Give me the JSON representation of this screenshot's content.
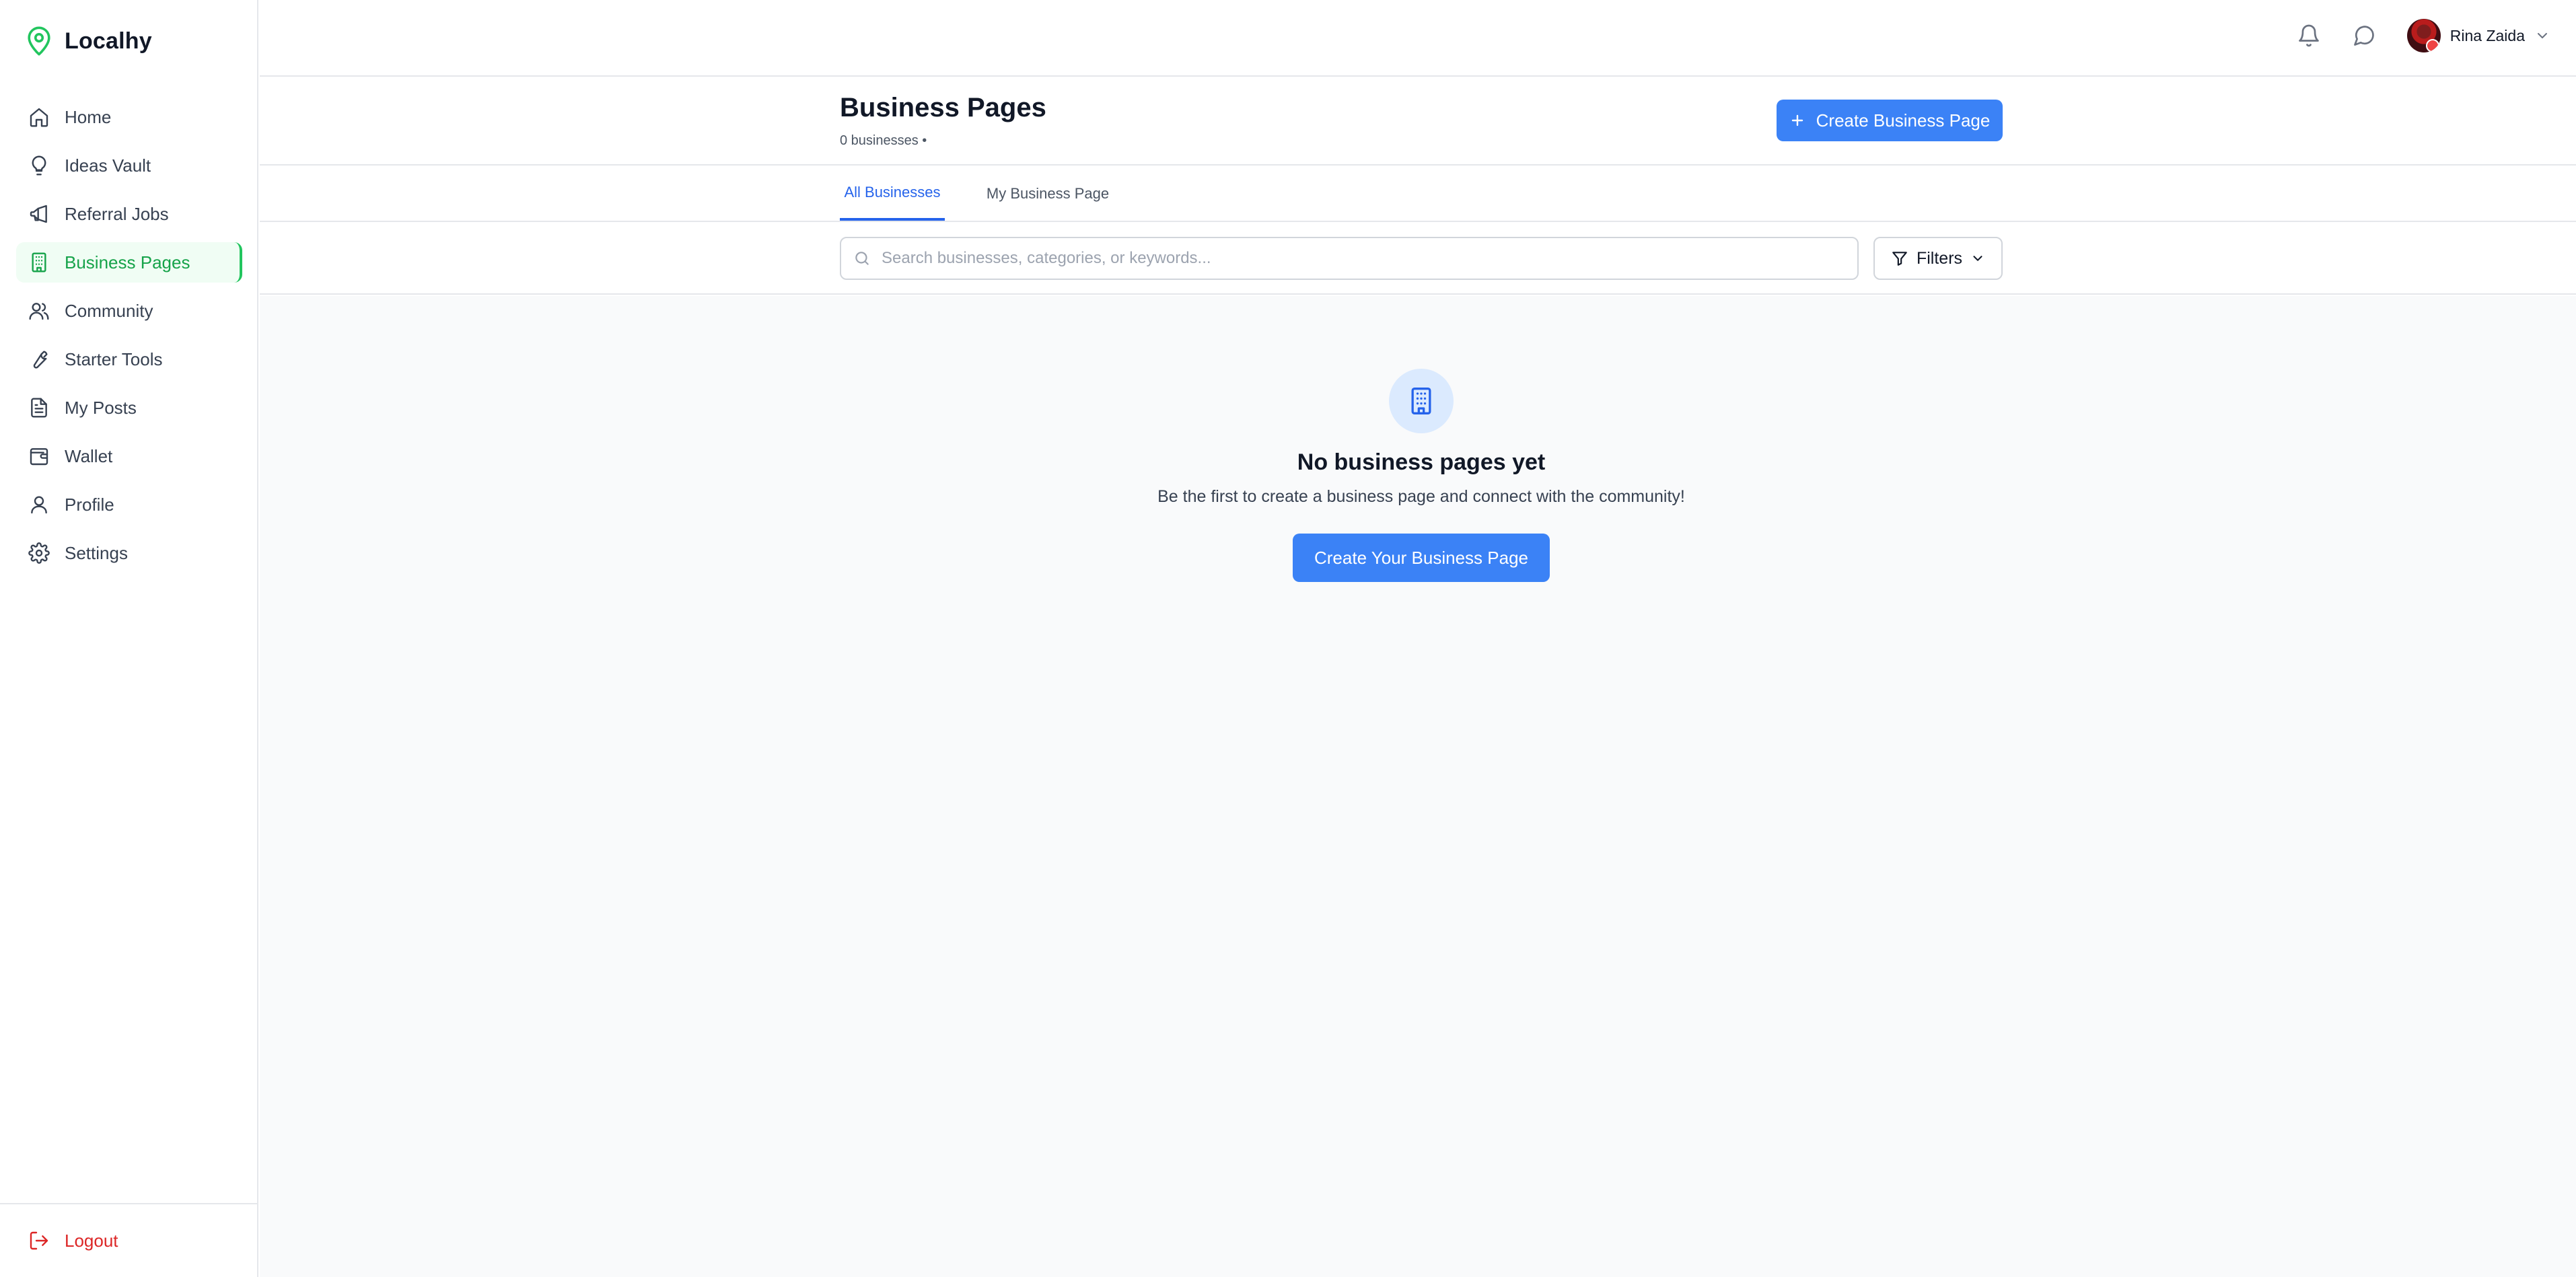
{
  "brand": {
    "name": "Localhy",
    "logo_icon": "map-pin-icon",
    "accent": "#22c55e"
  },
  "sidebar": {
    "items": [
      {
        "label": "Home",
        "icon": "home-icon"
      },
      {
        "label": "Ideas Vault",
        "icon": "lightbulb-icon"
      },
      {
        "label": "Referral Jobs",
        "icon": "megaphone-icon"
      },
      {
        "label": "Business Pages",
        "icon": "building-icon",
        "active": true
      },
      {
        "label": "Community",
        "icon": "users-icon"
      },
      {
        "label": "Starter Tools",
        "icon": "wrench-icon"
      },
      {
        "label": "My Posts",
        "icon": "document-icon"
      },
      {
        "label": "Wallet",
        "icon": "wallet-icon"
      },
      {
        "label": "Profile",
        "icon": "user-icon"
      },
      {
        "label": "Settings",
        "icon": "gear-icon"
      }
    ],
    "logout_label": "Logout",
    "logout_color": "#dc2626"
  },
  "topbar": {
    "user_name": "Rina Zaida",
    "icons": [
      "bell-icon",
      "message-icon",
      "chevron-down-icon"
    ]
  },
  "header": {
    "title": "Business Pages",
    "subtitle": "0 businesses •",
    "create_label": "Create Business Page",
    "primary_color": "#3b82f6"
  },
  "tabs": [
    {
      "label": "All Businesses",
      "active": true
    },
    {
      "label": "My Business Page",
      "active": false
    }
  ],
  "search": {
    "placeholder": "Search businesses, categories, or keywords...",
    "value": "",
    "filters_label": "Filters"
  },
  "empty_state": {
    "icon": "building-icon",
    "title": "No business pages yet",
    "description": "Be the first to create a business page and connect with the community!",
    "button_label": "Create Your Business Page"
  }
}
